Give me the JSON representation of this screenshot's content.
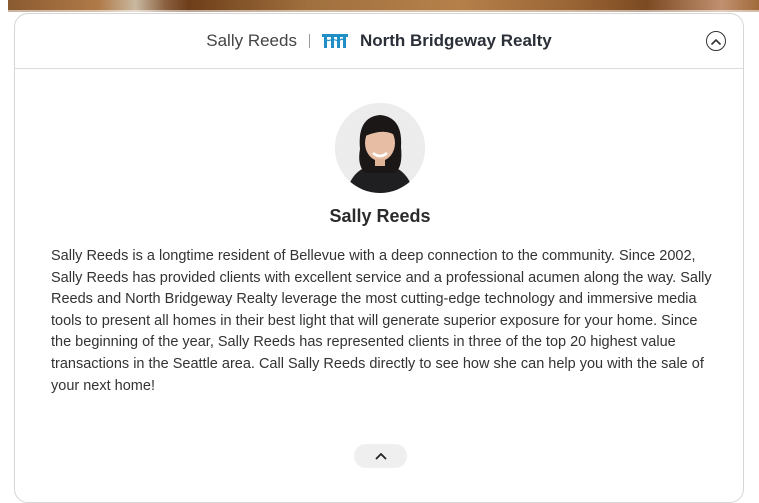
{
  "header": {
    "agent_name": "Sally Reeds",
    "brokerage_name": "North Bridgeway Realty",
    "brand_icon": "bridge-icon",
    "brand_color": "#1f8fc6",
    "collapse_icon": "chevron-up-circle-icon"
  },
  "profile": {
    "avatar_icon": "agent-photo",
    "name": "Sally Reeds",
    "bio": "Sally Reeds is a longtime resident of Bellevue with a deep connection to the community. Since 2002, Sally Reeds has provided clients with excellent service and a professional acumen along the way. Sally Reeds and North Bridgeway Realty leverage the most cutting-edge technology and immersive media tools to present all homes in their best light that will generate superior exposure for your home. Since the beginning of the year, Sally Reeds has represented clients in three of the top 20 highest value transactions in the Seattle area. Call Sally Reeds directly to see how she can help you with the sale of your next home!"
  },
  "footer": {
    "scroll_icon": "chevron-up-icon"
  }
}
